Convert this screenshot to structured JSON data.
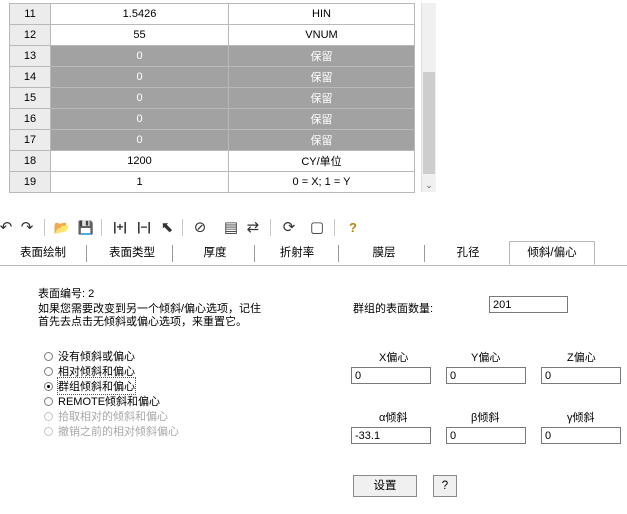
{
  "table": {
    "rows": [
      {
        "num": "11",
        "value": "1.5426",
        "name": "HIN",
        "dim": false
      },
      {
        "num": "12",
        "value": "55",
        "name": "VNUM",
        "dim": false
      },
      {
        "num": "13",
        "value": "0",
        "name": "保留",
        "dim": true
      },
      {
        "num": "14",
        "value": "0",
        "name": "保留",
        "dim": true
      },
      {
        "num": "15",
        "value": "0",
        "name": "保留",
        "dim": true
      },
      {
        "num": "16",
        "value": "0",
        "name": "保留",
        "dim": true
      },
      {
        "num": "17",
        "value": "0",
        "name": "保留",
        "dim": true
      },
      {
        "num": "18",
        "value": "1200",
        "name": "CY/单位",
        "dim": false
      },
      {
        "num": "19",
        "value": "1",
        "name": "0 = X; 1 = Y",
        "dim": false
      }
    ],
    "scroll_arrow": "⌄"
  },
  "toolbar": {
    "undo": "↶",
    "redo": "↷",
    "open": "📂",
    "save": "💾",
    "insert": "|+|",
    "span": "|−|",
    "pointer": "⬉",
    "lens": "⊘",
    "grid": "▤",
    "swap": "⇄",
    "refresh": "⟳",
    "window": "▢",
    "help": "?"
  },
  "tabs": [
    "表面绘制",
    "表面类型",
    "厚度",
    "折射率",
    "膜层",
    "孔径",
    "倾斜/偏心"
  ],
  "active_tab": "倾斜/偏心",
  "panel": {
    "surface_label": "表面编号: 2",
    "info_line1": "如果您需要改变到另一个倾斜/偏心选项，记住",
    "info_line2": "首先去点击无倾斜或偏心选项，来重置它。",
    "group_count_label": "群组的表面数量:",
    "group_count_value": "201",
    "options": [
      {
        "label": "没有倾斜或偏心",
        "selected": false,
        "disabled": false
      },
      {
        "label": "相对倾斜和偏心",
        "selected": false,
        "disabled": false
      },
      {
        "label": "群组倾斜和偏心",
        "selected": true,
        "disabled": false
      },
      {
        "label": "REMOTE倾斜和偏心",
        "selected": false,
        "disabled": false
      },
      {
        "label": "拾取相对的倾斜和偏心",
        "selected": false,
        "disabled": true
      },
      {
        "label": "撤销之前的相对倾斜偏心",
        "selected": false,
        "disabled": true
      }
    ],
    "x_dec_label": "X偏心",
    "y_dec_label": "Y偏心",
    "z_dec_label": "Z偏心",
    "x_dec_value": "0",
    "y_dec_value": "0",
    "z_dec_value": "0",
    "alpha_label": "α倾斜",
    "beta_label": "β倾斜",
    "gamma_label": "γ倾斜",
    "alpha_value": "-33.1",
    "beta_value": "0",
    "gamma_value": "0",
    "set_button": "设置",
    "help_button": "?"
  }
}
